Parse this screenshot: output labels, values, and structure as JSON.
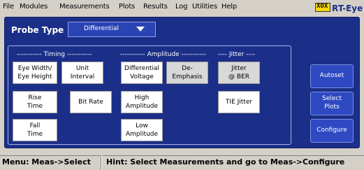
{
  "menu": [
    "File",
    "Modules",
    "Measurements",
    "Plots",
    "Results",
    "Log",
    "Utilities",
    "Help"
  ],
  "logo": {
    "mark": "XOX",
    "text": "RT-Eye"
  },
  "probe": {
    "label": "Probe Type",
    "value": "Differential"
  },
  "sections": {
    "timing": "----------- Timing -----------",
    "amplitude": "----------- Amplitude -----------",
    "jitter": "---- Jitter ----"
  },
  "measurements": {
    "eye_width": [
      "Eye Width/",
      "Eye Height"
    ],
    "unit_interval": [
      "Unit",
      "Interval"
    ],
    "differential_voltage": [
      "Differential",
      "Voltage"
    ],
    "de_emphasis": [
      "De-",
      "Emphasis"
    ],
    "jitter_ber": [
      "Jitter",
      "@ BER"
    ],
    "rise_time": [
      "Rise",
      "Time"
    ],
    "bit_rate": [
      "Bit Rate"
    ],
    "high_amplitude": [
      "High",
      "Amplitude"
    ],
    "tie_jitter": [
      "TIE Jitter"
    ],
    "fall_time": [
      "Fall",
      "Time"
    ],
    "low_amplitude": [
      "Low",
      "Amplitude"
    ]
  },
  "side_buttons": {
    "autoset": [
      "Autoset"
    ],
    "select_plots": [
      "Select",
      "Plots"
    ],
    "configure": [
      "Configure"
    ]
  },
  "status": {
    "menu_path": "Menu: Meas->Select",
    "hint": "Hint: Select Measurements and go to Meas->Configure"
  },
  "colors": {
    "panel": "#1b2f88",
    "accent_button": "#2e49c2",
    "logo_yellow": "#f5d800"
  }
}
